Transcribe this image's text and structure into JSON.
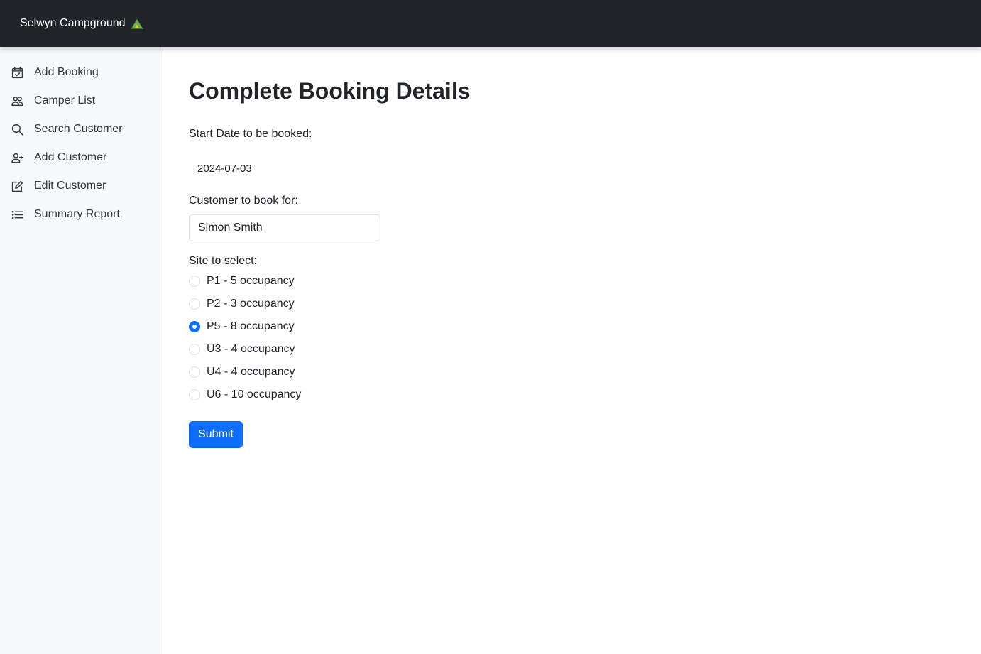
{
  "header": {
    "brand": "Selwyn Campground",
    "brand_icon": "camping-tent-emoji-icon"
  },
  "sidebar": {
    "items": [
      {
        "label": "Add Booking",
        "icon": "calendar-check-icon"
      },
      {
        "label": "Camper List",
        "icon": "people-icon"
      },
      {
        "label": "Search Customer",
        "icon": "search-icon"
      },
      {
        "label": "Add Customer",
        "icon": "person-add-icon"
      },
      {
        "label": "Edit Customer",
        "icon": "pencil-square-icon"
      },
      {
        "label": "Summary Report",
        "icon": "list-icon"
      }
    ]
  },
  "main": {
    "title": "Complete Booking Details",
    "start_date_label": "Start Date to be booked:",
    "start_date_value": "2024-07-03",
    "customer_label": "Customer to book for:",
    "customer_value": "Simon Smith",
    "site_label": "Site to select:",
    "sites": [
      {
        "label": "P1 - 5 occupancy",
        "checked": false
      },
      {
        "label": "P2 - 3 occupancy",
        "checked": false
      },
      {
        "label": "P5 - 8 occupancy",
        "checked": true
      },
      {
        "label": "U3 - 4 occupancy",
        "checked": false
      },
      {
        "label": "U4 - 4 occupancy",
        "checked": false
      },
      {
        "label": "U6 - 10 occupancy",
        "checked": false
      }
    ],
    "submit_label": "Submit"
  },
  "colors": {
    "topbar": "#212529",
    "sidebar": "#f8f9fa",
    "primary": "#0d6efd"
  }
}
